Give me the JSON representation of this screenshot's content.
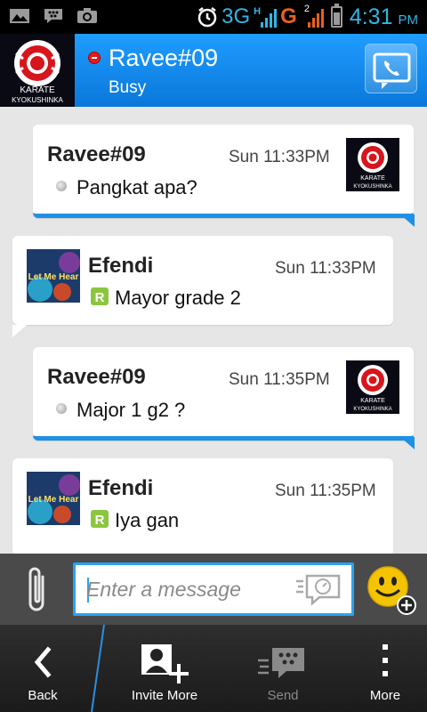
{
  "status_bar": {
    "network": "3G",
    "network_h": "H",
    "network2": "G",
    "sim2": "2",
    "time": "4:31",
    "ampm": "PM",
    "icons": [
      "gallery-icon",
      "bbm-icon",
      "camera-icon",
      "alarm-icon",
      "signal-icon",
      "battery-icon"
    ]
  },
  "header": {
    "contact_name": "Ravee#09",
    "contact_status": "Busy",
    "avatar_text_top": "KARATE",
    "avatar_text_bottom": "KYOKUSHINKA",
    "presence_color": "#e31b1b"
  },
  "messages": [
    {
      "direction": "out",
      "sender": "Ravee#09",
      "time": "Sun 11:33PM",
      "text": "Pangkat apa?",
      "marker": "dot"
    },
    {
      "direction": "in",
      "sender": "Efendi",
      "time": "Sun 11:33PM",
      "text": "Mayor grade 2",
      "marker": "R"
    },
    {
      "direction": "out",
      "sender": "Ravee#09",
      "time": "Sun 11:35PM",
      "text": "Major 1 g2 ?",
      "marker": "dot"
    },
    {
      "direction": "in",
      "sender": "Efendi",
      "time": "Sun 11:35PM",
      "text": "Iya gan",
      "marker": "R"
    }
  ],
  "avatars": {
    "karate_line1": "KARATE",
    "karate_line2": "KYOKUSHINKA",
    "efendi_text": "Let Me Hear"
  },
  "composer": {
    "placeholder": "Enter a message",
    "value": ""
  },
  "actions": [
    {
      "label": "Back",
      "icon": "back-arrow-icon",
      "enabled": true
    },
    {
      "label": "Invite More",
      "icon": "invite-more-icon",
      "enabled": true
    },
    {
      "label": "Send",
      "icon": "bbm-send-icon",
      "enabled": false
    },
    {
      "label": "More",
      "icon": "overflow-menu-icon",
      "enabled": true
    }
  ],
  "colors": {
    "header_blue": "#0a77da",
    "status_blue": "#33b5e5",
    "bubble_accent": "#1e90e6",
    "input_border": "#29a3f2",
    "r_badge": "#8cc63f"
  }
}
